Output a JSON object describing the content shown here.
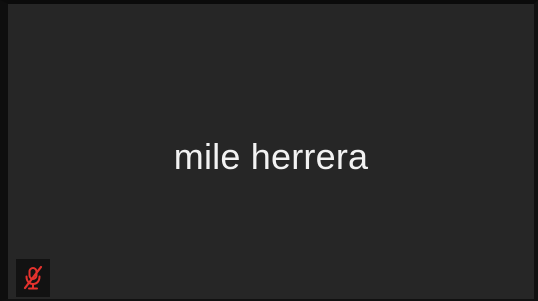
{
  "tile": {
    "participant_name": "mile herrera",
    "mic_status_icon": "mic-muted-icon"
  },
  "colors": {
    "background": "#262626",
    "name_text": "#f2f2f2",
    "muted_icon": "#e5322d"
  }
}
